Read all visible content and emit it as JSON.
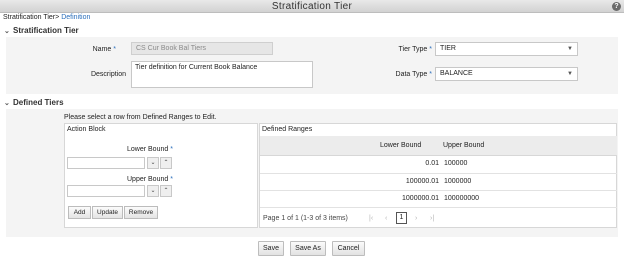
{
  "window": {
    "title": "Stratification Tier",
    "help_icon": "?"
  },
  "breadcrumb": {
    "parent": "Stratification Tier",
    "separator": ">",
    "current": "Definition"
  },
  "sections": {
    "tier": "Stratification Tier",
    "defined": "Defined Tiers"
  },
  "form": {
    "name_label": "Name",
    "name_value": "CS Cur Book Bal Tiers",
    "description_label": "Description",
    "description_value": "Tier definition for Current Book Balance",
    "tier_type_label": "Tier Type",
    "tier_type_value": "TIER",
    "data_type_label": "Data Type",
    "data_type_value": "BALANCE",
    "required_marker": "*"
  },
  "defined_tiers": {
    "hint": "Please select a row from Defined Ranges to Edit.",
    "action_block": {
      "title": "Action Block",
      "lower_bound_label": "Lower Bound",
      "upper_bound_label": "Upper Bound",
      "add_label": "Add",
      "update_label": "Update",
      "remove_label": "Remove"
    },
    "ranges": {
      "title": "Defined Ranges",
      "columns": [
        "Lower Bound",
        "Upper Bound"
      ],
      "rows": [
        [
          "0.01",
          "100000"
        ],
        [
          "100000.01",
          "1000000"
        ],
        [
          "1000000.01",
          "100000000"
        ]
      ],
      "pager": {
        "page_label": "Page",
        "page_num": "1",
        "of_label": "of 1",
        "summary": "(1-3 of 3 items)",
        "current": "1"
      }
    }
  },
  "footer": {
    "save_label": "Save",
    "save_as_label": "Save As",
    "cancel_label": "Cancel"
  },
  "colors": {
    "link": "#2a6ebb",
    "panel_bg": "#f4f4f4"
  }
}
